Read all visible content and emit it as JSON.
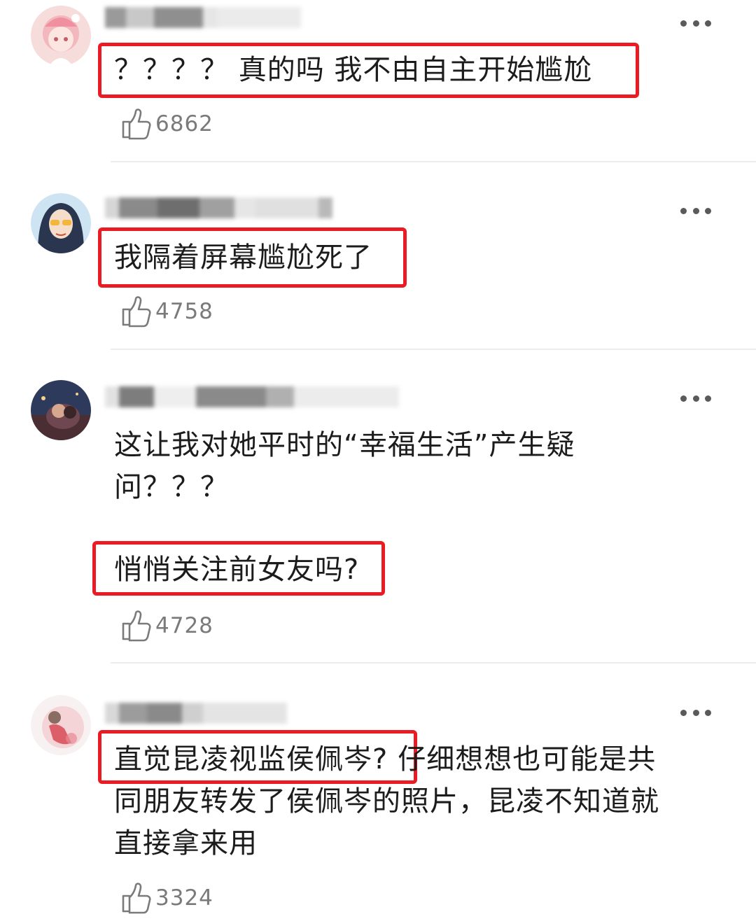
{
  "comments": [
    {
      "text": "？？？？ 真的吗 我不由自主开始尴尬",
      "likes": "6862"
    },
    {
      "text": "我隔着屏幕尴尬死了",
      "likes": "4758"
    },
    {
      "text_line1": "这让我对她平时的“幸福生活”产生疑",
      "text_line2": "问？？？",
      "text_line3": "悄悄关注前女友吗?",
      "likes": "4728"
    },
    {
      "text_hl": "直觉昆凌视监侯佩岑?",
      "text_rest1": "仔细想想也可能是共",
      "text_line2": "同朋友转发了侯佩岑的照片，昆凌不知道就",
      "text_line3": "直接拿来用",
      "likes": "3324"
    }
  ],
  "icons": {
    "more": "more-dots-icon",
    "like": "thumbs-up-icon"
  },
  "colors": {
    "highlight_box": "#ea1b22",
    "like_gray": "#7a7a7a"
  }
}
